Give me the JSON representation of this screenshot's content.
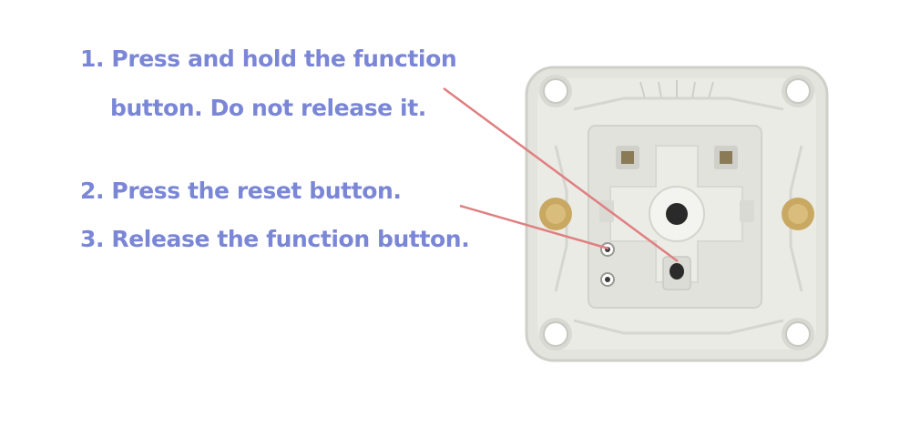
{
  "instructions": {
    "step1_line1": "1. Press and hold the function",
    "step1_line2": "button. Do not release it.",
    "step2": "2. Press the reset button.",
    "step3": "3. Release the function button."
  },
  "colors": {
    "text": "#7a86d6",
    "leader_line": "#e07f80",
    "module_body": "#e6e6e2",
    "brass_insert": "#c9a862"
  },
  "icons": {
    "module": "device-module-photo",
    "function_button": "function-button-hole",
    "reset_button": "reset-button-hole"
  }
}
